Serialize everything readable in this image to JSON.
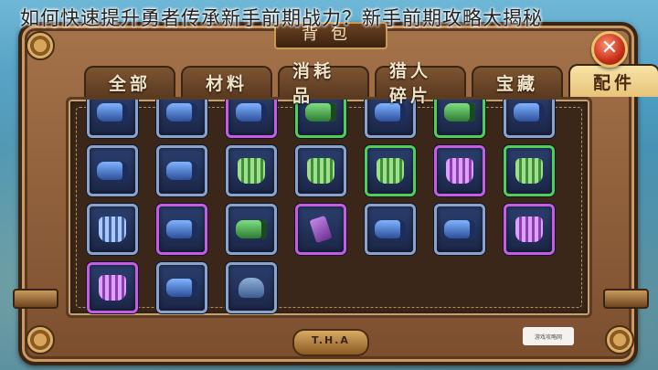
{
  "caption": "如何快速提升勇者传承新手前期战力？新手前期攻略大揭秘",
  "window": {
    "title": "背包",
    "close_label": "✕"
  },
  "tabs": [
    {
      "label": "全部",
      "active": false
    },
    {
      "label": "材料",
      "active": false
    },
    {
      "label": "消耗品",
      "active": false
    },
    {
      "label": "猎人碎片",
      "active": false
    },
    {
      "label": "宝藏",
      "active": false
    },
    {
      "label": "配件",
      "active": true
    }
  ],
  "items": [
    {
      "frame": "blue",
      "art": "cannon-blue-icon"
    },
    {
      "frame": "blue",
      "art": "cannon-blue-icon"
    },
    {
      "frame": "purple",
      "art": "cannon-purple-icon"
    },
    {
      "frame": "green",
      "art": "cannon-green-icon"
    },
    {
      "frame": "blue",
      "art": "cannon-blue-icon"
    },
    {
      "frame": "green",
      "art": "cannon-green-icon"
    },
    {
      "frame": "blue",
      "art": "cannon-blue-icon"
    },
    {
      "frame": "blue",
      "art": "cannon-blue-icon"
    },
    {
      "frame": "blue",
      "art": "cannon-blue-icon"
    },
    {
      "frame": "blue",
      "art": "armor-green-icon"
    },
    {
      "frame": "blue",
      "art": "armor-green-icon"
    },
    {
      "frame": "green",
      "art": "armor-green-icon"
    },
    {
      "frame": "purple",
      "art": "armor-purple-icon"
    },
    {
      "frame": "green",
      "art": "armor-green-icon"
    },
    {
      "frame": "blue",
      "art": "armor-blue-icon"
    },
    {
      "frame": "purple",
      "art": "cannon-purple-icon"
    },
    {
      "frame": "blue",
      "art": "cannon-green-icon"
    },
    {
      "frame": "purple",
      "art": "radio-purple-icon"
    },
    {
      "frame": "blue",
      "art": "cannon-blue-icon"
    },
    {
      "frame": "blue",
      "art": "cannon-blue-icon"
    },
    {
      "frame": "purple",
      "art": "armor-purple-icon"
    },
    {
      "frame": "purple",
      "art": "armor-purple-icon"
    },
    {
      "frame": "blue",
      "art": "cannon-blue-icon"
    },
    {
      "frame": "blue",
      "art": "mask-blue-icon"
    }
  ],
  "emblem": "T.H.A",
  "watermark": "游戏攻略网"
}
